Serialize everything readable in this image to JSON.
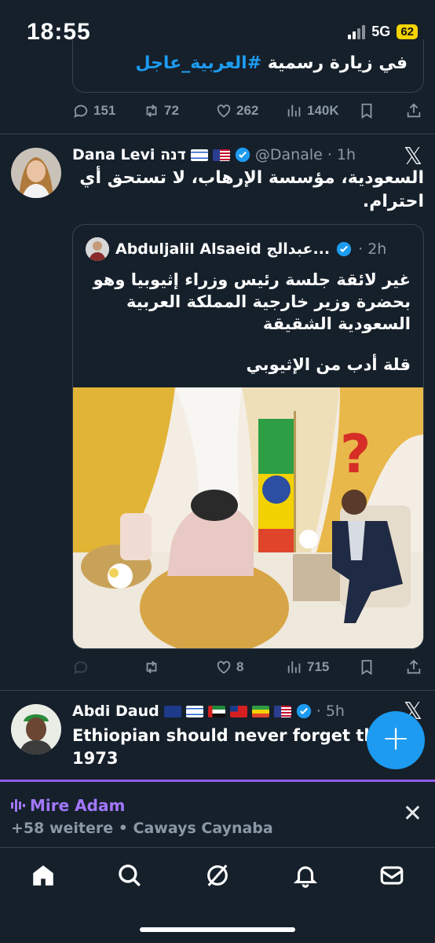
{
  "status_bar": {
    "time": "18:55",
    "network": "5G",
    "battery": "62"
  },
  "prev_tweet": {
    "quote_text_prefix": "في زيارة رسمية ",
    "quote_text_tag": "#العربية_عاجل",
    "stats": {
      "replies": "151",
      "retweets": "72",
      "likes": "262",
      "views": "140K"
    }
  },
  "tweet1": {
    "name": "Dana Levi דנה",
    "handle": "@Danale",
    "time": "· 1h",
    "text_line1": "السعودية، مؤسسة الإرهاب، لا تستحق أي",
    "text_line2": "احترام.",
    "quote": {
      "name": "Abduljalil Alsaeid عبدالج...",
      "time": "· 2h",
      "line1": "غير لائقة جلسة رئيس وزراء إثيوبيا وهو",
      "line2": "بحضرة وزير خارجية المملكة العربية",
      "line3": "السعودية الشقيقة",
      "line4": "قلة أدب من الإثيوبي"
    },
    "stats": {
      "replies": "",
      "retweets": "",
      "likes": "8",
      "views": "715"
    }
  },
  "tweet2": {
    "name": "Abdi Daud",
    "time": "· 5h",
    "text_line1": "Ethiopian should never forget this d",
    "text_line2": "1973"
  },
  "fab": {
    "label": "+"
  },
  "spaces": {
    "title": "Mire Adam",
    "subtitle": "+58 weitere • Caways Caynaba",
    "close": "✕"
  },
  "icons": [
    "home-icon",
    "search-icon",
    "grok-icon",
    "notifications-icon",
    "messages-icon"
  ],
  "colors": {
    "background": "#15202b",
    "accent": "#1d9bf0",
    "spaces": "#a277ff",
    "muted": "#8b98a5"
  }
}
